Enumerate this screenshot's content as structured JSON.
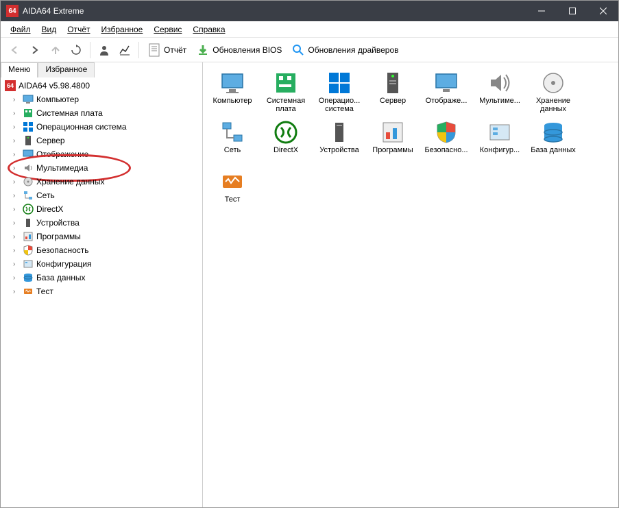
{
  "titlebar": {
    "title": "AIDA64 Extreme"
  },
  "menubar": {
    "file": "Файл",
    "view": "Вид",
    "report": "Отчёт",
    "favorites": "Избранное",
    "service": "Сервис",
    "help": "Справка"
  },
  "toolbar": {
    "report_label": "Отчёт",
    "bios_label": "Обновления BIOS",
    "drivers_label": "Обновления драйверов"
  },
  "sidebar": {
    "tabs": {
      "menu": "Меню",
      "favorites": "Избранное"
    },
    "root": "AIDA64 v5.98.4800",
    "items": [
      {
        "label": "Компьютер"
      },
      {
        "label": "Системная плата"
      },
      {
        "label": "Операционная система"
      },
      {
        "label": "Сервер"
      },
      {
        "label": "Отображение"
      },
      {
        "label": "Мультимедиа"
      },
      {
        "label": "Хранение данных"
      },
      {
        "label": "Сеть"
      },
      {
        "label": "DirectX"
      },
      {
        "label": "Устройства"
      },
      {
        "label": "Программы"
      },
      {
        "label": "Безопасность"
      },
      {
        "label": "Конфигурация"
      },
      {
        "label": "База данных"
      },
      {
        "label": "Тест"
      }
    ]
  },
  "main": {
    "icons": [
      {
        "label": "Компьютер"
      },
      {
        "label": "Системная плата"
      },
      {
        "label": "Операцио... система"
      },
      {
        "label": "Сервер"
      },
      {
        "label": "Отображе..."
      },
      {
        "label": "Мультиме..."
      },
      {
        "label": "Хранение данных"
      },
      {
        "label": "Сеть"
      },
      {
        "label": "DirectX"
      },
      {
        "label": "Устройства"
      },
      {
        "label": "Программы"
      },
      {
        "label": "Безопасно..."
      },
      {
        "label": "Конфигур..."
      },
      {
        "label": "База данных"
      },
      {
        "label": "Тест"
      }
    ]
  }
}
